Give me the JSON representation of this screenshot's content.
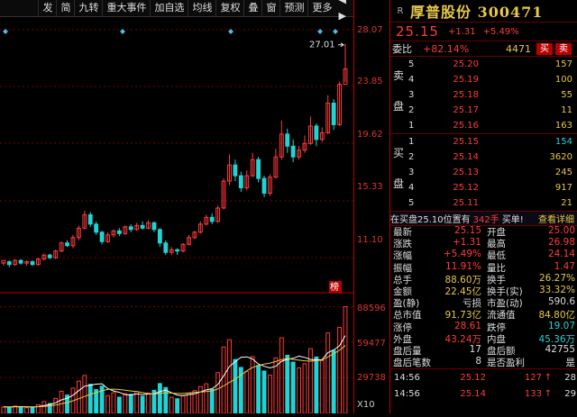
{
  "toolbar": {
    "items": [
      "发",
      "简",
      "九转",
      "重大事件",
      "加自选",
      "均线",
      "复权",
      "叠",
      "窗",
      "预测",
      "更多"
    ],
    "arrows": "◀ ▶"
  },
  "colors": {
    "up": "#ff3b3b",
    "down": "#23d3d3",
    "ma1": "#ffffff",
    "ma2": "#e6c84a",
    "ma3": "#e040e0"
  },
  "chart": {
    "peak_label": "27.01",
    "rank_badge": "榜",
    "y_axis": [
      "28.07",
      "23.85",
      "19.62",
      "15.33",
      "11.10"
    ],
    "vol_axis": [
      "88596",
      "59477",
      "29738",
      "X10"
    ]
  },
  "chart_data": {
    "type": "candlestick",
    "price_ylim": [
      8.9,
      29.0
    ],
    "candles": [
      [
        10.7,
        10.9,
        10.5,
        10.8
      ],
      [
        10.8,
        10.6,
        10.4,
        10.9
      ],
      [
        10.6,
        10.9,
        10.5,
        11.0
      ],
      [
        10.9,
        10.7,
        10.6,
        11.0
      ],
      [
        10.7,
        10.8,
        10.5,
        10.9
      ],
      [
        10.8,
        10.6,
        10.5,
        10.9
      ],
      [
        10.6,
        11.0,
        10.5,
        11.1
      ],
      [
        11.0,
        11.3,
        10.9,
        11.4
      ],
      [
        11.3,
        11.1,
        11.0,
        11.4
      ],
      [
        11.1,
        11.6,
        11.0,
        11.7
      ],
      [
        11.6,
        12.2,
        11.5,
        12.3
      ],
      [
        12.2,
        12.0,
        11.9,
        12.4
      ],
      [
        12.0,
        12.6,
        11.8,
        12.8
      ],
      [
        12.6,
        13.3,
        12.4,
        13.5
      ],
      [
        13.3,
        14.3,
        13.2,
        14.6
      ],
      [
        14.3,
        13.6,
        13.4,
        14.5
      ],
      [
        13.6,
        13.0,
        12.8,
        13.8
      ],
      [
        13.0,
        12.3,
        12.1,
        13.1
      ],
      [
        12.3,
        12.8,
        12.2,
        13.0
      ],
      [
        12.8,
        13.1,
        12.6,
        13.2
      ],
      [
        13.1,
        12.9,
        12.7,
        13.3
      ],
      [
        12.9,
        13.4,
        12.8,
        13.5
      ],
      [
        13.4,
        13.2,
        13.0,
        13.6
      ],
      [
        13.2,
        13.5,
        13.1,
        13.7
      ],
      [
        13.5,
        13.3,
        13.2,
        13.8
      ],
      [
        13.3,
        13.7,
        13.2,
        13.9
      ],
      [
        13.7,
        13.2,
        13.0,
        13.8
      ],
      [
        13.2,
        12.2,
        11.9,
        13.3
      ],
      [
        12.2,
        11.5,
        11.3,
        12.4
      ],
      [
        11.5,
        11.7,
        11.3,
        11.9
      ],
      [
        11.7,
        11.6,
        11.3,
        11.8
      ],
      [
        11.6,
        12.1,
        11.5,
        12.2
      ],
      [
        12.1,
        12.6,
        12.0,
        12.8
      ],
      [
        12.6,
        13.0,
        12.5,
        13.1
      ],
      [
        13.0,
        13.6,
        12.9,
        13.8
      ],
      [
        13.6,
        14.1,
        13.5,
        14.3
      ],
      [
        14.1,
        13.8,
        13.6,
        14.4
      ],
      [
        13.8,
        14.8,
        13.7,
        15.0
      ],
      [
        14.8,
        16.8,
        14.7,
        17.0
      ],
      [
        16.8,
        18.0,
        16.5,
        18.8
      ],
      [
        18.0,
        17.2,
        16.8,
        18.4
      ],
      [
        17.2,
        16.3,
        16.0,
        17.5
      ],
      [
        16.3,
        17.2,
        16.1,
        17.6
      ],
      [
        17.2,
        18.4,
        17.1,
        18.9
      ],
      [
        18.4,
        17.0,
        16.7,
        18.6
      ],
      [
        17.0,
        15.9,
        15.6,
        17.2
      ],
      [
        15.9,
        17.1,
        15.7,
        17.3
      ],
      [
        17.1,
        18.6,
        17.0,
        19.2
      ],
      [
        18.6,
        20.3,
        18.4,
        21.3
      ],
      [
        20.3,
        19.4,
        18.9,
        20.7
      ],
      [
        19.4,
        18.6,
        18.2,
        19.9
      ],
      [
        18.6,
        19.1,
        18.4,
        19.4
      ],
      [
        19.1,
        19.6,
        18.9,
        20.2
      ],
      [
        19.6,
        20.9,
        19.5,
        21.6
      ],
      [
        20.9,
        19.9,
        19.4,
        21.1
      ],
      [
        19.9,
        20.4,
        19.7,
        20.8
      ],
      [
        20.4,
        22.6,
        20.3,
        23.2
      ],
      [
        22.6,
        21.0,
        20.6,
        22.9
      ],
      [
        21.0,
        24.0,
        20.9,
        24.2
      ],
      [
        24.0,
        25.15,
        24.14,
        27.01
      ]
    ],
    "volume_ylim": [
      0,
      95000
    ],
    "volumes": [
      5200,
      4800,
      6100,
      5400,
      4700,
      5000,
      7200,
      9800,
      8300,
      12500,
      18400,
      15200,
      21000,
      26800,
      31500,
      24200,
      19800,
      22600,
      14800,
      17200,
      13500,
      16400,
      15800,
      18100,
      14300,
      16900,
      19200,
      24800,
      21500,
      13400,
      12200,
      14700,
      16800,
      18900,
      22300,
      24600,
      20100,
      33800,
      55200,
      61200,
      44800,
      38200,
      34700,
      47200,
      39800,
      35200,
      31900,
      46200,
      62800,
      48300,
      42600,
      37800,
      41200,
      53700,
      46900,
      43800,
      66800,
      52300,
      71400,
      88596
    ],
    "ma_series": [
      {
        "values": [
          5500,
          5400,
          5600,
          5700,
          5500,
          5300,
          5600,
          6500,
          7200,
          8800,
          11200,
          12600,
          15100,
          18900,
          22600,
          23400,
          24300,
          24600,
          20600,
          18600,
          17500,
          15500,
          15300,
          16200,
          15600,
          16100,
          16300,
          18100,
          19300,
          17300,
          15200,
          14800,
          15600,
          16200,
          17800,
          19500,
          20500,
          24000,
          31200,
          39000,
          43000,
          46600,
          47000,
          45200,
          41000,
          39100,
          37800,
          39100,
          43300,
          44900,
          45800,
          47600,
          46500,
          44800,
          44500,
          44700,
          50500,
          52700,
          56200,
          64600
        ]
      },
      {
        "values": [
          5300,
          5300,
          5400,
          5400,
          5400,
          5400,
          5500,
          5800,
          6200,
          6900,
          8000,
          9000,
          10500,
          12200,
          14100,
          15800,
          17300,
          18700,
          19900,
          20200,
          19800,
          19200,
          18600,
          18100,
          17300,
          16400,
          16000,
          16600,
          17100,
          16900,
          16500,
          16500,
          17000,
          17500,
          17800,
          18200,
          18700,
          20300,
          22800,
          25700,
          28500,
          31700,
          35400,
          38200,
          39700,
          40900,
          41800,
          43100,
          44700,
          45600,
          44800,
          44200,
          43700,
          43400,
          43800,
          44300,
          46900,
          49600,
          52400,
          56300
        ]
      }
    ]
  },
  "quote": {
    "R": "R",
    "name": "厚普股份 300471",
    "price": "25.15",
    "change": "+1.31",
    "pct": "+5.49%"
  },
  "weibi": {
    "label": "委比",
    "value": "+82.14%",
    "vol": "4471",
    "btn_sell": "买",
    "btn_buy": "卖"
  },
  "sell": {
    "side": [
      "卖",
      "盘"
    ],
    "rows": [
      {
        "lvl": "5",
        "price": "25.20",
        "vol": "157"
      },
      {
        "lvl": "4",
        "price": "25.19",
        "vol": "100"
      },
      {
        "lvl": "3",
        "price": "25.18",
        "vol": "55"
      },
      {
        "lvl": "2",
        "price": "25.17",
        "vol": "11"
      },
      {
        "lvl": "1",
        "price": "25.16",
        "vol": "163"
      }
    ]
  },
  "buy": {
    "side": [
      "买",
      "盘"
    ],
    "rows": [
      {
        "lvl": "1",
        "price": "25.15",
        "vol": "154"
      },
      {
        "lvl": "2",
        "price": "25.14",
        "vol": "3620"
      },
      {
        "lvl": "3",
        "price": "25.13",
        "vol": "245"
      },
      {
        "lvl": "4",
        "price": "25.12",
        "vol": "917"
      },
      {
        "lvl": "5",
        "price": "25.11",
        "vol": "21"
      }
    ]
  },
  "note": {
    "t1": "在买盘25.10位置有",
    "t2": "342手",
    "t3": "买单!",
    "t4": "查看详细"
  },
  "stats": [
    [
      {
        "l": "最新",
        "v": "25.15",
        "c": ""
      },
      {
        "l": "开盘",
        "v": "25.00",
        "c": ""
      }
    ],
    [
      {
        "l": "涨跌",
        "v": "+1.31",
        "c": ""
      },
      {
        "l": "最高",
        "v": "26.98",
        "c": ""
      }
    ],
    [
      {
        "l": "涨幅",
        "v": "+5.49%",
        "c": ""
      },
      {
        "l": "最低",
        "v": "24.14",
        "c": ""
      }
    ],
    [
      {
        "l": "振幅",
        "v": "11.91%",
        "c": ""
      },
      {
        "l": "量比",
        "v": "1.47",
        "c": ""
      }
    ],
    [
      {
        "l": "总手",
        "v": "88.60万",
        "c": "y"
      },
      {
        "l": "换手",
        "v": "26.27%",
        "c": "y"
      }
    ],
    [
      {
        "l": "金额",
        "v": "22.45亿",
        "c": "y"
      },
      {
        "l": "换手(实)",
        "v": "33.32%",
        "c": "y"
      }
    ],
    [
      {
        "l": "盈(静)",
        "v": "亏损",
        "c": "w"
      },
      {
        "l": "市盈(动)",
        "v": "590.6",
        "c": "w"
      }
    ],
    [
      {
        "l": "总市值",
        "v": "91.73亿",
        "c": "y"
      },
      {
        "l": "流通值",
        "v": "84.80亿",
        "c": "y"
      }
    ],
    [
      {
        "l": "涨停",
        "v": "28.61",
        "c": ""
      },
      {
        "l": "跌停",
        "v": "19.07",
        "c": "g"
      }
    ],
    [
      {
        "l": "外盘",
        "v": "43.24万",
        "c": ""
      },
      {
        "l": "内盘",
        "v": "45.36万",
        "c": "g"
      }
    ],
    [
      {
        "l": "盘后量",
        "v": "17",
        "c": "w"
      },
      {
        "l": "盘后额",
        "v": "42755",
        "c": "w"
      }
    ],
    [
      {
        "l": "盘后笔数",
        "v": "8",
        "c": "w"
      },
      {
        "l": "是否盈利",
        "v": "是",
        "c": "w"
      }
    ]
  ],
  "ticks": [
    {
      "time": "14:56",
      "price": "25.12",
      "vol": "127",
      "arrow": "↑",
      "n": "28"
    },
    {
      "time": "14:56",
      "price": "25.14",
      "vol": "133",
      "arrow": "↑",
      "n": "29"
    }
  ]
}
